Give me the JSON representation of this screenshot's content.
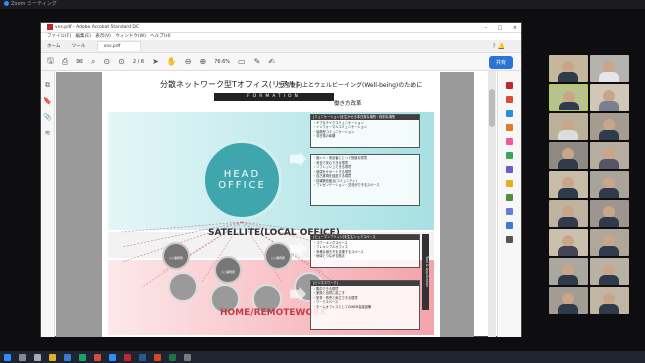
{
  "zoom": {
    "title": "Zoom ミーティング"
  },
  "window": {
    "title": "vns.pdf - Adobe Acrobat Standard DC",
    "menu": [
      "ファイル(F)",
      "編集(E)",
      "表示(V)",
      "ウィンドウ(W)",
      "ヘルプ(H)"
    ],
    "tabs": [
      "ホーム",
      "ツール",
      "vns.pdf"
    ],
    "controls": [
      "–",
      "□",
      "×"
    ],
    "page_indicator": "2 / 6",
    "zoom_level": "76.6%",
    "share_label": "共有"
  },
  "slide": {
    "title": "分散ネットワーク型Tオフィス(リアル)",
    "subtitle": "生産性向上とウェルビーイング(Well-being)のために",
    "formation": "FORMATION",
    "reform": "働き方改革",
    "head_office": "HEAD OFFICE",
    "satellite": "SATELLITE(LOCAL OFFICE)",
    "home": "HOME/REMOTEWORK",
    "vertical_tab": "Tool & Application",
    "box1_title": "[ミュニケーション]を生かせる非日常な場所・特別な場所",
    "box1_lines": [
      "・ギブ＆テイクコミュニケーション",
      "・インフォーマルコミュニケーション",
      "・協働型コミュニケーション",
      "・非日常の体験"
    ],
    "box2_lines": [
      "・働く人・来訪者にとって快適な環境",
      "・安全で安心できる環境",
      "・リフレッシュできる環境",
      "・健康をサポートする環境",
      "・自己実現を促進する環境",
      "・情報発信拠点(コミュニティ)",
      "・プレゼンテーション・交流ができるスペース"
    ],
    "box3_title": "[ヒューマンブリッジ]を生むシェアスペース",
    "box3_lines": [
      "・コワーキングスペース",
      "・フレキシブルオフィス",
      "・多様な働き方を支援するスペース",
      "・地域とつながる拠点"
    ],
    "box4_title": "[ビジネスワーク]",
    "box4_lines": [
      "・集中できる環境",
      "・家族と自然に過ごす",
      "・家事・育児と両立できる環境",
      "・ワークスペース",
      "・ホームオフィスとしてのWEB会議設備"
    ],
    "satellite_nodes": [
      "○○事務所",
      "○○事務所",
      "○○事務所"
    ]
  }
}
